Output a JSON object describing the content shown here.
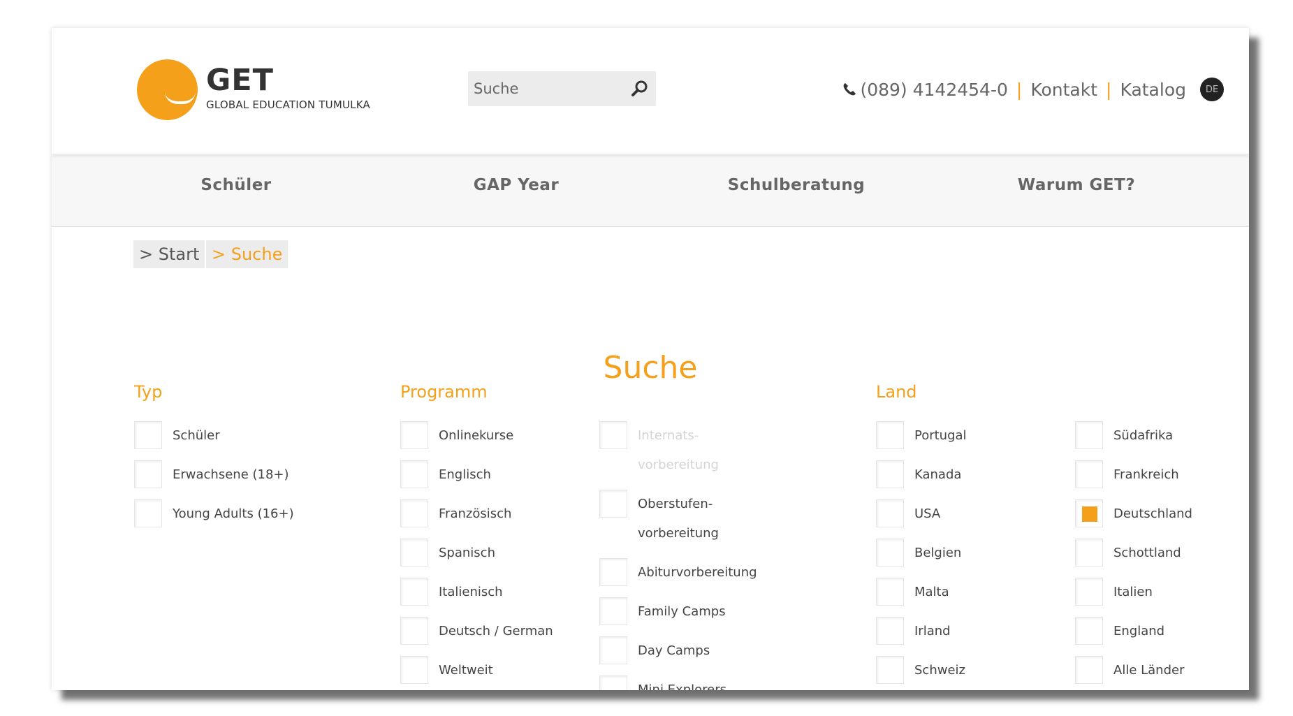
{
  "header": {
    "logo": {
      "title": "GET",
      "subtitle": "GLOBAL EDUCATION TUMULKA"
    },
    "search": {
      "placeholder": "Suche"
    },
    "phone": "(089) 4142454-0",
    "links": [
      "Kontakt",
      "Katalog"
    ],
    "language": "DE"
  },
  "nav": [
    "Schüler",
    "GAP Year",
    "Schulberatung",
    "Warum GET?"
  ],
  "breadcrumb": [
    "> Start",
    "> Suche"
  ],
  "page_title": "Suche",
  "filters": {
    "typ": {
      "title": "Typ",
      "options": [
        "Schüler",
        "Erwachsene (18+)",
        "Young Adults (16+)"
      ]
    },
    "programm": {
      "title": "Programm",
      "col1": [
        "Onlinekurse",
        "Englisch",
        "Französisch",
        "Spanisch",
        "Italienisch",
        "Deutsch / German",
        "Weltweit"
      ],
      "col2": [
        {
          "line1": "Internats-",
          "line2": "vorbereitung",
          "disabled": true
        },
        {
          "line1": "Oberstufen-",
          "line2": "vorbereitung",
          "disabled": false
        },
        {
          "line1": "Abiturvorbereitung"
        },
        {
          "line1": "Family Camps"
        },
        {
          "line1": "Day Camps"
        },
        {
          "line1": "Mini Explorers"
        }
      ]
    },
    "land": {
      "title": "Land",
      "col1": [
        "Portugal",
        "Kanada",
        "USA",
        "Belgien",
        "Malta",
        "Irland",
        "Schweiz"
      ],
      "col2": [
        "Südafrika",
        "Frankreich",
        "Deutschland",
        "Schottland",
        "Italien",
        "England",
        "Alle Länder"
      ],
      "checked": "Deutschland"
    }
  },
  "colors": {
    "accent": "#f5a01a",
    "text": "#444444"
  }
}
